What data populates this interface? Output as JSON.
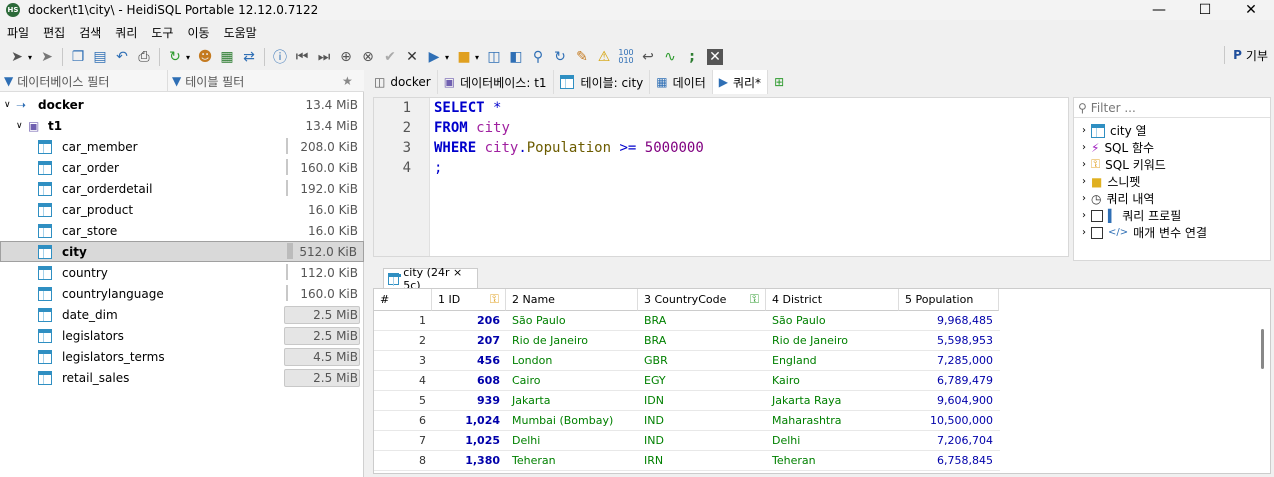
{
  "window": {
    "title": "docker\\t1\\city\\ - HeidiSQL Portable 12.12.0.7122",
    "app_icon_text": "HS"
  },
  "menu": [
    "파일",
    "편집",
    "검색",
    "쿼리",
    "도구",
    "이동",
    "도움말"
  ],
  "toolbar": {
    "donate_label": "기부"
  },
  "filters": {
    "db_filter": "데이터베이스 필터",
    "table_filter": "테이블 필터"
  },
  "tree": {
    "server": {
      "label": "docker",
      "size": "13.4 MiB"
    },
    "database": {
      "label": "t1",
      "size": "13.4 MiB"
    },
    "tables": [
      {
        "label": "car_member",
        "size": "208.0 KiB"
      },
      {
        "label": "car_order",
        "size": "160.0 KiB"
      },
      {
        "label": "car_orderdetail",
        "size": "192.0 KiB"
      },
      {
        "label": "car_product",
        "size": "16.0 KiB"
      },
      {
        "label": "car_store",
        "size": "16.0 KiB"
      },
      {
        "label": "city",
        "size": "512.0 KiB"
      },
      {
        "label": "country",
        "size": "112.0 KiB"
      },
      {
        "label": "countrylanguage",
        "size": "160.0 KiB"
      },
      {
        "label": "date_dim",
        "size": "2.5 MiB"
      },
      {
        "label": "legislators",
        "size": "2.5 MiB"
      },
      {
        "label": "legislators_terms",
        "size": "4.5 MiB"
      },
      {
        "label": "retail_sales",
        "size": "2.5 MiB"
      }
    ]
  },
  "tabs": [
    {
      "label": "docker"
    },
    {
      "label": "데이터베이스: t1"
    },
    {
      "label": "테이블: city"
    },
    {
      "label": "데이터"
    },
    {
      "label": "쿼리*"
    }
  ],
  "editor": {
    "line_numbers": [
      "1",
      "2",
      "3",
      "4"
    ],
    "lines": [
      [
        "SELECT",
        " ",
        "*"
      ],
      [
        "FROM",
        " ",
        "city"
      ],
      [
        "WHERE",
        " ",
        "city",
        ".",
        "Population",
        " ",
        ">=",
        " ",
        "5000000"
      ],
      [
        ";"
      ]
    ]
  },
  "helper": {
    "filter_placeholder": "Filter ...",
    "items": [
      "city 열",
      "SQL 함수",
      "SQL 키워드",
      "스니펫",
      "쿼리 내역",
      "쿼리 프로필",
      "매개 변수 연결"
    ]
  },
  "result": {
    "tab_label": "city (24r × 5c)",
    "columns": [
      "#",
      "1 ID",
      "2 Name",
      "3 CountryCode",
      "4 District",
      "5 Population"
    ],
    "rows": [
      [
        "1",
        "206",
        "São Paulo",
        "BRA",
        "São Paulo",
        "9,968,485"
      ],
      [
        "2",
        "207",
        "Rio de Janeiro",
        "BRA",
        "Rio de Janeiro",
        "5,598,953"
      ],
      [
        "3",
        "456",
        "London",
        "GBR",
        "England",
        "7,285,000"
      ],
      [
        "4",
        "608",
        "Cairo",
        "EGY",
        "Kairo",
        "6,789,479"
      ],
      [
        "5",
        "939",
        "Jakarta",
        "IDN",
        "Jakarta Raya",
        "9,604,900"
      ],
      [
        "6",
        "1,024",
        "Mumbai (Bombay)",
        "IND",
        "Maharashtra",
        "10,500,000"
      ],
      [
        "7",
        "1,025",
        "Delhi",
        "IND",
        "Delhi",
        "7,206,704"
      ],
      [
        "8",
        "1,380",
        "Teheran",
        "IRN",
        "Teheran",
        "6,758,845"
      ]
    ]
  }
}
